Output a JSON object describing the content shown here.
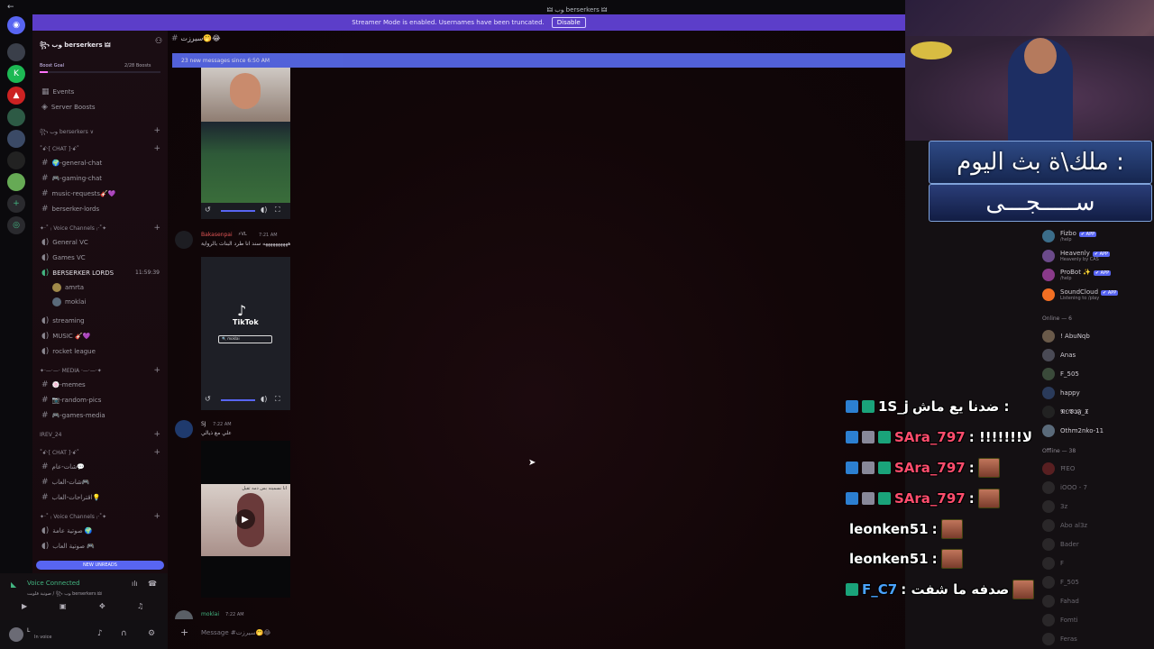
{
  "topbar": {
    "title": "🜲 ﻮب berserkers 🜲"
  },
  "streamer_banner": {
    "text": "Streamer Mode is enabled. Usernames have been truncated.",
    "button": "Disable"
  },
  "server": {
    "name": "꧂ ﻮب berserkers 🜲",
    "boost_goal": "Boost Goal",
    "boosts": "2/28 Boosts",
    "events": "Events",
    "server_boosts": "Server Boosts",
    "sections": [
      {
        "label": "꧂ ﻮب berserkers ∨"
      },
      {
        "label": "˚ꗃ·[ CHAT ]·ꗃ˚"
      },
      {
        "label": "✦·˚ ₍ Voice Channels ₎·˚✦"
      },
      {
        "label": "✦·—·—· MEDIA ·—·—·✦"
      },
      {
        "label": "IREV_24"
      },
      {
        "label": "˚ꗃ·[ CHAT ]·ꗃ˚"
      },
      {
        "label": "✦·˚ ₍ Voice Channels ₎·˚✦"
      }
    ],
    "channels_a": [
      "🌍-general-chat",
      "🎮-gaming-chat",
      "music-requests🎸💜",
      "berserker-lords"
    ],
    "voice_a": [
      "General VC",
      "Games VC",
      "BERSERKER LORDS"
    ],
    "voice_time": "11:59:39",
    "voice_users": [
      "amrta",
      "moklai"
    ],
    "voice_b": [
      "streaming",
      "MUSIC 🎸💜",
      "rocket league"
    ],
    "media": [
      "🍥-memes",
      "📷-random-pics",
      "🎮-games-media"
    ],
    "chat2": [
      "شات-عام💬",
      "شات-العاب🎮",
      "اقتراحات-العاب💡"
    ],
    "voice2": [
      "صوتية عامة 🌍",
      "صوتية العاب 🎮"
    ],
    "new_unreads": "NEW UNREADS"
  },
  "voice_panel": {
    "status": "Voice Connected",
    "channel": "صوتية قلوبت / ꧂ ﻮب berserkers 🜲"
  },
  "user_panel": {
    "name": "L",
    "status": "In voice"
  },
  "channel": {
    "name": "سيرزت🤭😂",
    "new_messages": "23 new messages since 6:50 AM"
  },
  "messages": [
    {
      "author": "Bakasenpai",
      "time": "7:21 AM",
      "text": "ههههههههههه سند انا طرد البنات بالرواية",
      "color": "#e05656"
    },
    {
      "author": "SJ",
      "time": "7:22 AM",
      "text": "علي مع ذيالي",
      "color": "#cfcbd2"
    },
    {
      "author": "moklai",
      "time": "7:22 AM",
      "text": "",
      "color": "#43b581"
    }
  ],
  "tiktok": {
    "label": "TikTok",
    "search": "🔍 moklai"
  },
  "video_caption": "انا نسمينه بس دمه ثقيل",
  "composer": {
    "placeholder": "Message #سيرزت🤭😂"
  },
  "members": {
    "apps": [
      {
        "name": "Fizbo",
        "sub": "/help",
        "tag": "✔ APP"
      },
      {
        "name": "Heavenly",
        "sub": "Heavenly by CAS",
        "tag": "✔ APP"
      },
      {
        "name": "ProBot ✨",
        "sub": "/help",
        "tag": "✔ APP"
      },
      {
        "name": "SoundCloud",
        "sub": "Listening to /play",
        "tag": "✔ APP"
      }
    ],
    "online_header": "Online — 6",
    "online": [
      "! AbuNqb",
      "Anas",
      "F_505",
      "happy",
      "𝕹𝕺𝖁𝕴𝕱_𝖃",
      "Othm2nko-11"
    ],
    "offline_header": "Offline — 38",
    "offline": [
      "ĦEO",
      "iOOO - 7",
      "3z",
      "Abo al3z",
      "Bader",
      "F",
      "F_505",
      "Fahad",
      "Fomti",
      "Feras"
    ]
  },
  "stream": {
    "banner_line1": "ملك\\ة بث اليوم :",
    "banner_line2": "ســـــجـــى"
  },
  "chat_overlay": [
    {
      "user": "1S_j",
      "user_color": "#ffffff",
      "message": "ضدنا يع ماش :",
      "emote": false
    },
    {
      "user": "SAra_797",
      "user_color": "#ff4d6d",
      "message": ": !!!!!!!لا",
      "emote": false
    },
    {
      "user": "SAra_797",
      "user_color": "#ff4d6d",
      "message": ":",
      "emote": true
    },
    {
      "user": "SAra_797",
      "user_color": "#ff4d6d",
      "message": ":",
      "emote": true
    },
    {
      "user": "leonken51",
      "user_color": "#ffffff",
      "message": ":",
      "emote": true
    },
    {
      "user": "leonken51",
      "user_color": "#ffffff",
      "message": ":",
      "emote": true
    },
    {
      "user": "F_C7",
      "user_color": "#4aa3ff",
      "message": ": صدفه ما شفت",
      "emote": true
    }
  ],
  "colors": {
    "accent": "#5865f2",
    "streamer_bar": "#5c3ec9",
    "new_bar": "#5a6cf0"
  }
}
